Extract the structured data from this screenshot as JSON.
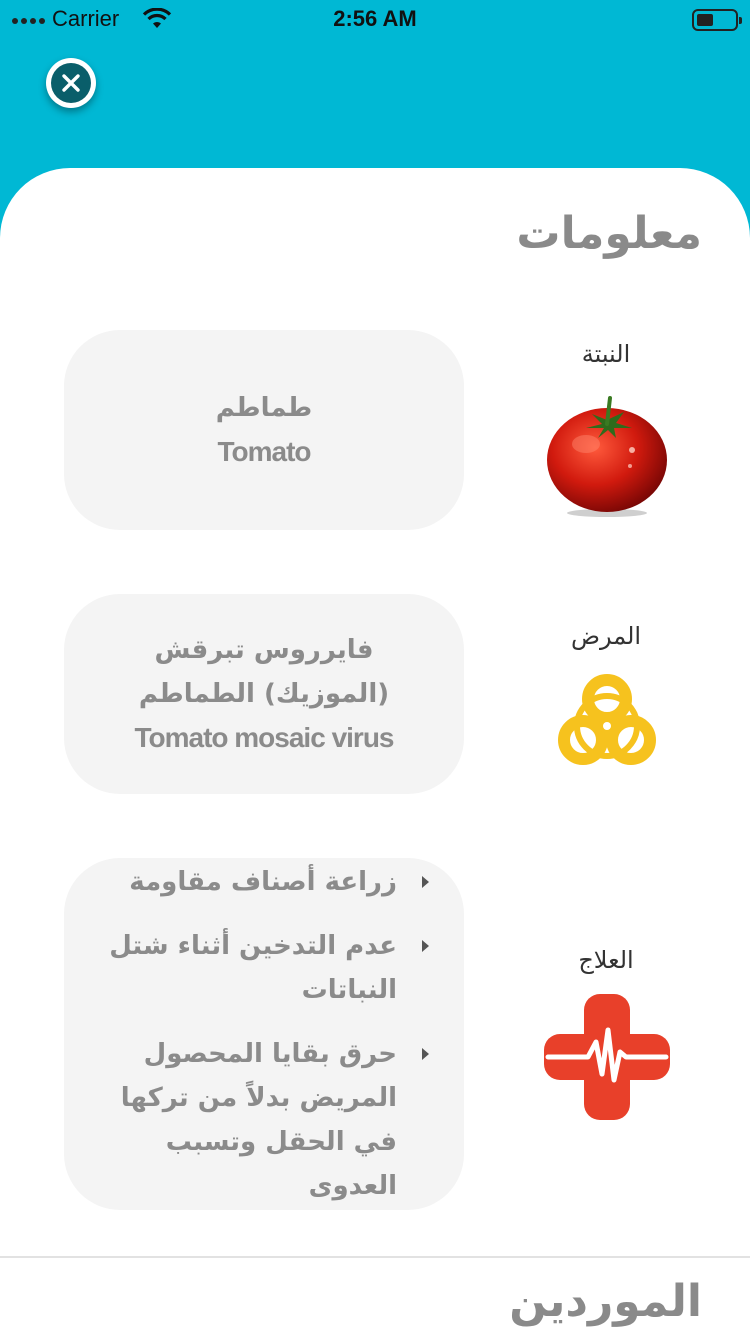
{
  "status_bar": {
    "carrier": "Carrier",
    "time": "2:56 AM"
  },
  "info": {
    "title": "معلومات",
    "plant": {
      "label": "النبتة",
      "name_ar": "طماطم",
      "name_en": "Tomato",
      "icon": "tomato-icon"
    },
    "disease": {
      "label": "المرض",
      "name_ar": "فايرروس تبرقش (الموزيك) الطماطم",
      "name_en": "Tomato mosaic virus",
      "icon": "biohazard-icon"
    },
    "treatment": {
      "label": "العلاج",
      "icon": "medical-cross-icon",
      "items": [
        "زراعة أصناف مقاومة",
        "عدم التدخين أثناء شتل النباتات",
        "حرق بقايا المحصول المريض بدلاً من تركها في الحقل وتسبب العدوى"
      ]
    }
  },
  "providers": {
    "title": "الموردين"
  },
  "colors": {
    "header": "#00b8d4",
    "close_button": "#0a5e6a",
    "card_bg": "#f4f4f4",
    "biohazard": "#f6c21e",
    "medical": "#e8402a"
  }
}
